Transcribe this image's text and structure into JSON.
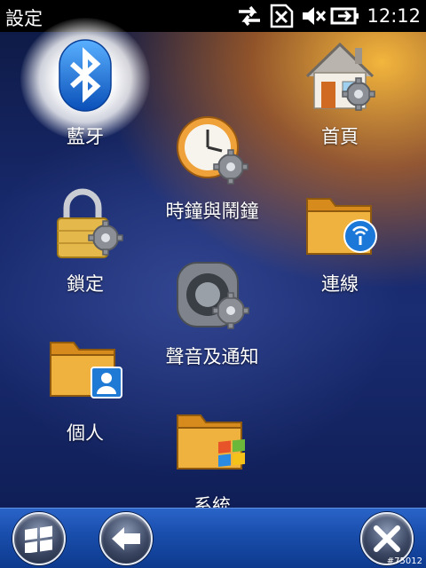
{
  "status_bar": {
    "title": "設定",
    "time": "12:12",
    "icons": [
      "connectivity-arrows-icon",
      "no-sim-icon",
      "speaker-muted-icon",
      "battery-charging-icon"
    ]
  },
  "items": {
    "bluetooth": {
      "label": "藍牙",
      "icon": "bluetooth-icon"
    },
    "home": {
      "label": "首頁",
      "icon": "home-settings-icon"
    },
    "clock": {
      "label": "時鐘與鬧鐘",
      "icon": "clock-alarm-icon"
    },
    "lock": {
      "label": "鎖定",
      "icon": "lock-icon"
    },
    "connections": {
      "label": "連線",
      "icon": "connections-folder-icon"
    },
    "sounds": {
      "label": "聲音及通知",
      "icon": "sound-settings-icon"
    },
    "personal": {
      "label": "個人",
      "icon": "personal-folder-icon"
    },
    "system": {
      "label": "系統",
      "icon": "system-folder-icon"
    }
  },
  "bottom_bar": {
    "buttons": [
      "windows-start-icon",
      "back-arrow-icon",
      "close-icon"
    ]
  },
  "watermark": "#75012"
}
